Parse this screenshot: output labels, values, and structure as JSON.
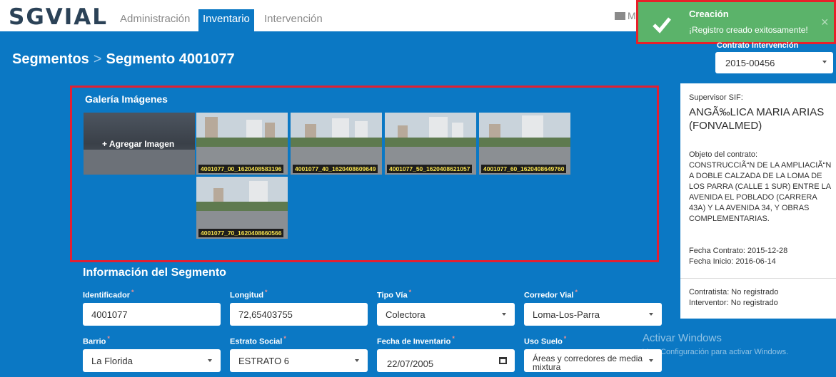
{
  "app": {
    "logo": "SGVIAL",
    "nav": [
      {
        "label": "Administración"
      },
      {
        "label": "Inventario",
        "active": true
      },
      {
        "label": "Intervención"
      }
    ],
    "mail_label": "M"
  },
  "toast": {
    "title": "Creación",
    "message": "¡Registro creado exitosamente!",
    "close": "×",
    "color": "#5bb36a"
  },
  "breadcrumb": {
    "parent": "Segmentos",
    "separator": ">",
    "current": "Segmento 4001077"
  },
  "contract": {
    "label": "Contrato Intervención",
    "selected": "2015-00456"
  },
  "gallery": {
    "title": "Galería Imágenes",
    "add_label": "+ Agregar Imagen",
    "images": [
      {
        "caption": "4001077_00_1620408583196"
      },
      {
        "caption": "4001077_40_1620408609649"
      },
      {
        "caption": "4001077_50_1620408621057"
      },
      {
        "caption": "4001077_60_1620408649760"
      },
      {
        "caption": "4001077_70_1620408660566"
      }
    ]
  },
  "info": {
    "supervisor_label": "Supervisor SIF:",
    "supervisor_name": "ANGÃ‰LICA MARIA ARIAS (FONVALMED)",
    "object_label": "Objeto del contrato:",
    "object_text": "CONSTRUCCIÃ“N DE LA AMPLIACIÃ“N A DOBLE CALZADA DE LA LOMA DE LOS PARRA (CALLE 1 SUR) ENTRE LA AVENIDA EL POBLADO (CARRERA 43A) Y LA AVENIDA 34, Y OBRAS COMPLEMENTARIAS.",
    "contract_date": "Fecha Contrato: 2015-12-28",
    "start_date": "Fecha Inicio: 2016-06-14",
    "contractor": "Contratista: No registrado",
    "auditor": "Interventor: No registrado"
  },
  "segment": {
    "title": "Información del Segmento",
    "fields": {
      "identificador": {
        "label": "Identificador",
        "value": "4001077"
      },
      "longitud": {
        "label": "Longitud",
        "value": "72,65403755"
      },
      "tipo_via": {
        "label": "Tipo Vía",
        "value": "Colectora"
      },
      "corredor": {
        "label": "Corredor Vial",
        "value": "Loma-Los-Parra"
      },
      "barrio": {
        "label": "Barrio",
        "value": "La Florida"
      },
      "estrato": {
        "label": "Estrato Social",
        "value": "ESTRATO 6"
      },
      "fecha_inv": {
        "label": "Fecha de Inventario",
        "value": "22/07/2005"
      },
      "uso_suelo": {
        "label": "Uso Suelo",
        "value": "Áreas y corredores de media mixtura"
      }
    }
  },
  "watermark": {
    "line1": "Activar Windows",
    "line2": "Ve a Configuración para activar Windows."
  }
}
